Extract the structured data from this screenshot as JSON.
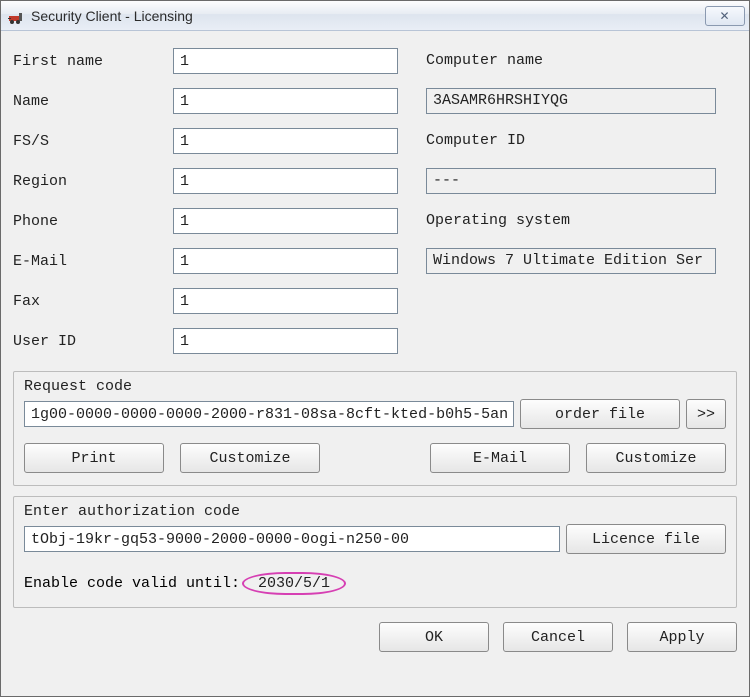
{
  "window": {
    "title": "Security Client - Licensing",
    "close_glyph": "✕"
  },
  "left_fields": {
    "first_name": {
      "label": "First name",
      "value": "1"
    },
    "name": {
      "label": "Name",
      "value": "1"
    },
    "fs_s": {
      "label": "FS/S",
      "value": "1"
    },
    "region": {
      "label": "Region",
      "value": "1"
    },
    "phone": {
      "label": "Phone",
      "value": "1"
    },
    "email": {
      "label": "E-Mail",
      "value": "1"
    },
    "fax": {
      "label": "Fax",
      "value": "1"
    },
    "user_id": {
      "label": "User ID",
      "value": "1"
    }
  },
  "right_fields": {
    "computer_name": {
      "label": "Computer name",
      "value": "3ASAMR6HRSHIYQG"
    },
    "computer_id": {
      "label": "Computer ID",
      "value": "---"
    },
    "os": {
      "label": "Operating system",
      "value": "Windows 7 Ultimate Edition Ser"
    }
  },
  "request": {
    "label": "Request code",
    "value": "1g00-0000-0000-0000-2000-r831-08sa-8cft-kted-b0h5-5an",
    "order_file_label": "order file",
    "more_label": ">>",
    "print_label": "Print",
    "customize_label": "Customize",
    "email_label": "E-Mail",
    "customize2_label": "Customize"
  },
  "auth": {
    "label": "Enter authorization code",
    "value": "tObj-19kr-gq53-9000-2000-0000-0ogi-n250-00",
    "licence_file_label": "Licence file"
  },
  "valid": {
    "label": "Enable code valid until:",
    "date": "2030/5/1"
  },
  "buttons": {
    "ok": "OK",
    "cancel": "Cancel",
    "apply": "Apply"
  }
}
